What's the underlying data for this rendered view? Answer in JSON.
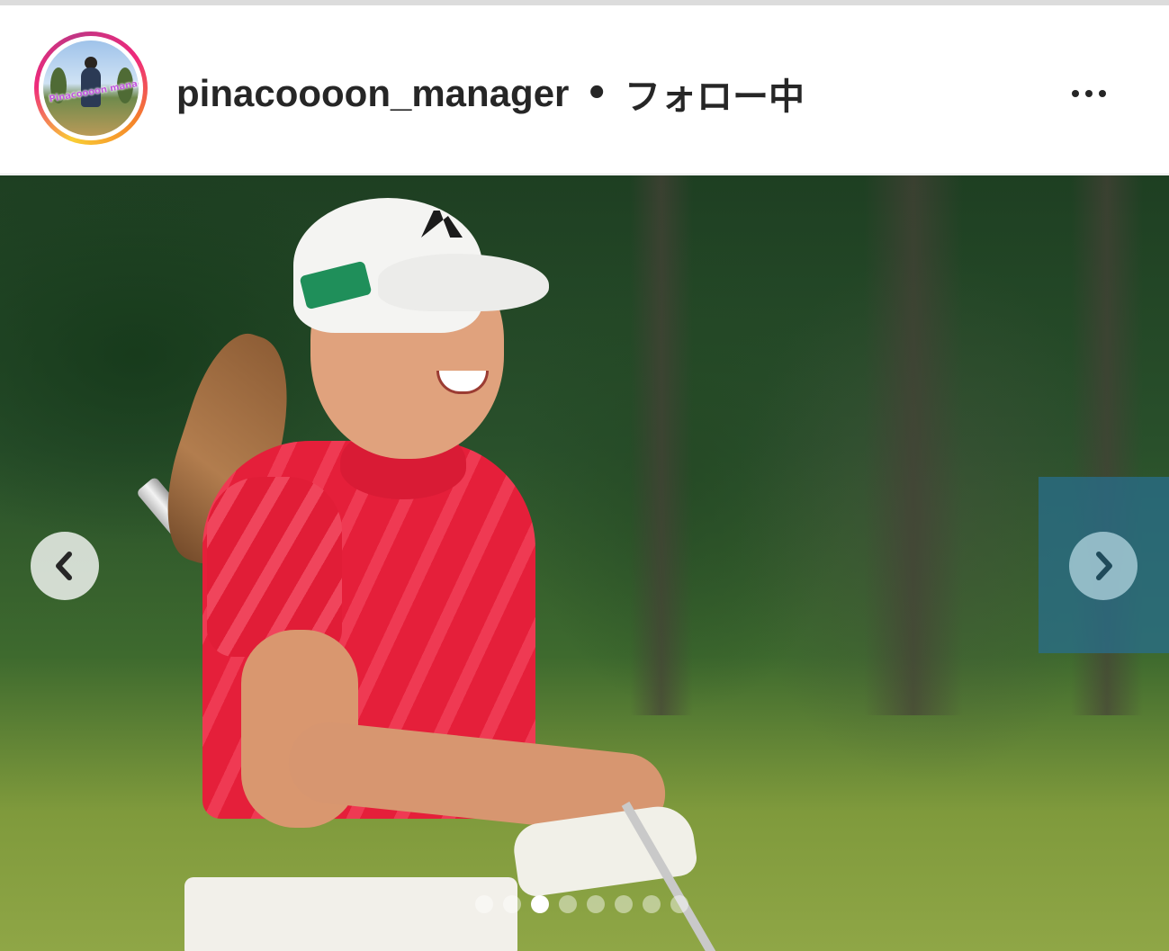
{
  "post_header": {
    "avatar_text": "Pinacoooon manager",
    "username": "pinacoooon_manager",
    "separator": "•",
    "follow_status": "フォロー中",
    "more_icon": "more-horizontal-icon"
  },
  "carousel": {
    "image_subject": "golfer-photo",
    "prev_icon": "chevron-left-icon",
    "next_icon": "chevron-right-icon",
    "current_index": 3,
    "total": 8
  },
  "colors": {
    "story_ring": "#ee2a7b",
    "text": "#262626",
    "shirt": "#e51f3a"
  }
}
